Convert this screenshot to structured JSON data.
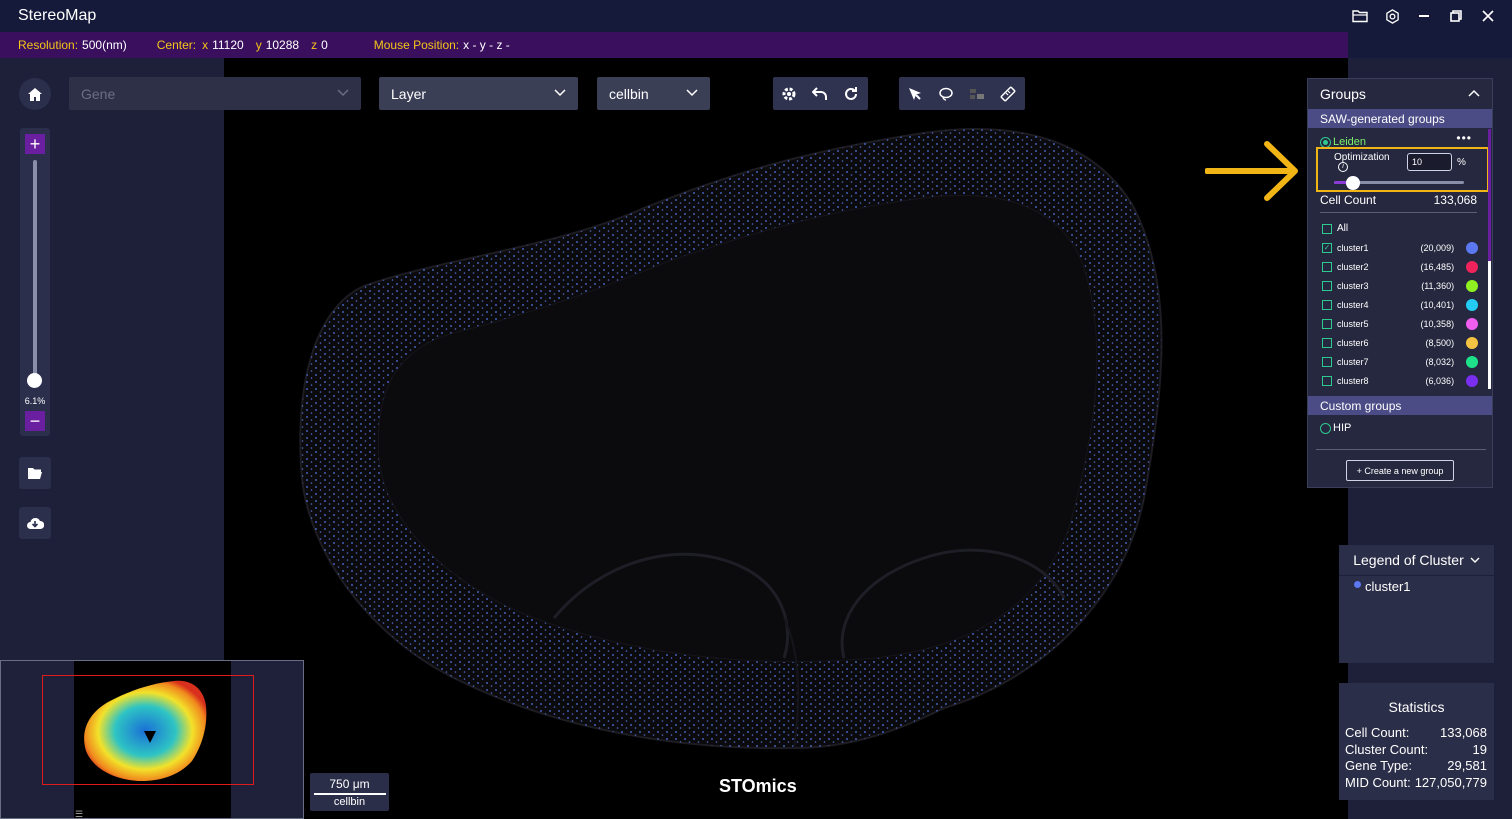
{
  "app": {
    "title": "StereoMap"
  },
  "infobar": {
    "resolution_label": "Resolution:",
    "resolution_value": "500(nm)",
    "center_label": "Center:",
    "center_x_label": "x",
    "center_x": "11120",
    "center_y_label": "y",
    "center_y": "10288",
    "center_z_label": "z",
    "center_z": "0",
    "mouse_label": "Mouse Position:",
    "mouse_value": "x -  y -  z -"
  },
  "toolbar": {
    "gene_placeholder": "Gene",
    "layer_label": "Layer",
    "cellbin_label": "cellbin"
  },
  "zoom": {
    "percent": "6.1%",
    "plus": "+",
    "minus": "−",
    "level": 0.061
  },
  "groups": {
    "title": "Groups",
    "saw_title": "SAW-generated groups",
    "leiden_label": "Leiden",
    "more": "•••",
    "optimization_label": "Optimization",
    "optimization_value": "10",
    "optimization_unit": "%",
    "optimization_level": 0.1,
    "cell_count_label": "Cell Count",
    "cell_count_value": "133,068",
    "all_label": "All",
    "clusters": [
      {
        "name": "cluster1",
        "count": "(20,009)",
        "color": "#5b78f0",
        "checked": true
      },
      {
        "name": "cluster2",
        "count": "(16,485)",
        "color": "#f0245a",
        "checked": false
      },
      {
        "name": "cluster3",
        "count": "(11,360)",
        "color": "#8ff022",
        "checked": false
      },
      {
        "name": "cluster4",
        "count": "(10,401)",
        "color": "#22ccf2",
        "checked": false
      },
      {
        "name": "cluster5",
        "count": "(10,358)",
        "color": "#f05ef0",
        "checked": false
      },
      {
        "name": "cluster6",
        "count": "(8,500)",
        "color": "#f5c342",
        "checked": false
      },
      {
        "name": "cluster7",
        "count": "(8,032)",
        "color": "#1fe08a",
        "checked": false
      },
      {
        "name": "cluster8",
        "count": "(6,036)",
        "color": "#7a2ff0",
        "checked": false
      }
    ],
    "custom_title": "Custom groups",
    "hip_label": "HIP",
    "new_group_label": "+ Create a new group"
  },
  "legend": {
    "title": "Legend of Cluster",
    "items": [
      {
        "name": "cluster1",
        "color": "#5b78f0"
      }
    ]
  },
  "statistics": {
    "title": "Statistics",
    "rows": [
      {
        "label": "Cell Count:",
        "value": "133,068"
      },
      {
        "label": "Cluster Count:",
        "value": "19"
      },
      {
        "label": "Gene Type:",
        "value": "29,581"
      },
      {
        "label": "MID Count:",
        "value": "127,050,779"
      }
    ]
  },
  "scalebar": {
    "length": "750 μm",
    "layer": "cellbin"
  },
  "brand": "STOmics",
  "colors": {
    "accent": "#6a1fa0",
    "highlight": "#f2b516",
    "infobar_label": "#f5c518",
    "dots": "#5b78f0"
  }
}
